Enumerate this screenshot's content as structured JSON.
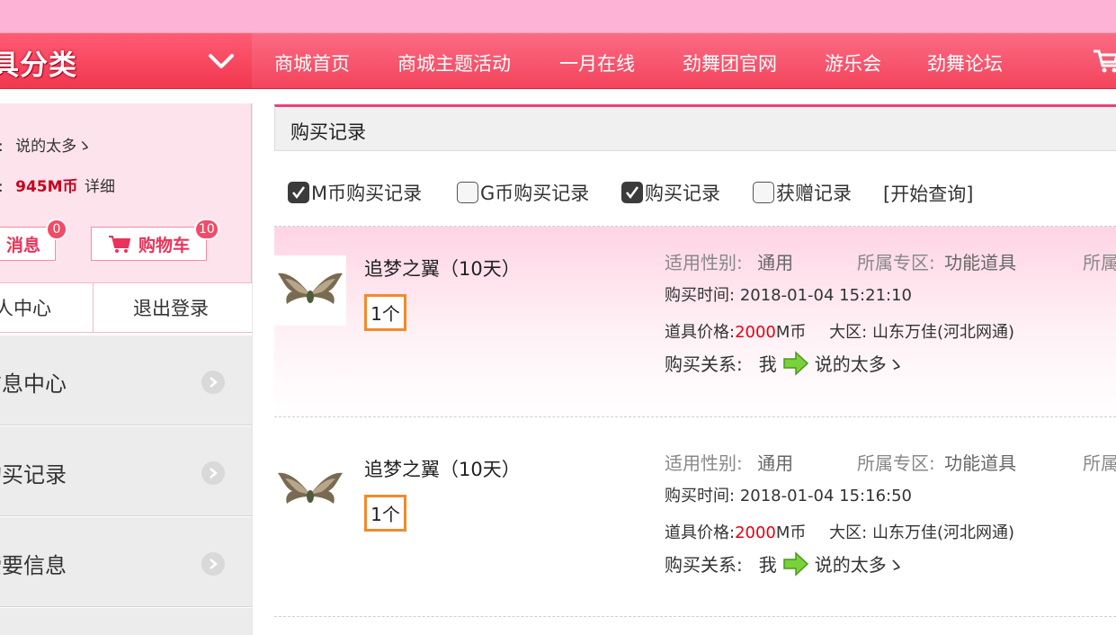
{
  "nav": {
    "category_title": "具分类",
    "links": [
      "商城首页",
      "商城主题活动",
      "一月在线",
      "劲舞团官网",
      "游乐会",
      "劲舞论坛"
    ]
  },
  "user": {
    "name_prefix": ":",
    "name": "说的太多ゝ",
    "balance_prefix": ":",
    "balance": "945M币",
    "detail_link": "详细",
    "messages_label": "消息",
    "messages_count": "0",
    "cart_label": "购物车",
    "cart_count": "10",
    "center_link": "人中心",
    "logout_link": "退出登录"
  },
  "sidebar": {
    "items": [
      {
        "label": "信息中心"
      },
      {
        "label": "购买记录"
      },
      {
        "label": "索要信息"
      }
    ]
  },
  "main": {
    "title": "购买记录",
    "filters": [
      {
        "label": "M币购买记录",
        "checked": true
      },
      {
        "label": "G币购买记录",
        "checked": false
      },
      {
        "label": "购买记录",
        "checked": true
      },
      {
        "label": "获赠记录",
        "checked": false
      }
    ],
    "query_button": "[开始查询]"
  },
  "labels": {
    "gender": "适用性别:",
    "zone": "所属专区:",
    "zone_cut": "所属",
    "time": "购买时间:",
    "price": "道具价格:",
    "price_unit": "M币",
    "region": "大区:",
    "relation": "购买关系:",
    "me": "我"
  },
  "records": [
    {
      "name": "追梦之翼（10天）",
      "qty": "1个",
      "gender": "通用",
      "zone": "功能道具",
      "time": "2018-01-04 15:21:10",
      "price": "2000",
      "region": "山东万佳(河北网通)",
      "to": "说的太多ゝ"
    },
    {
      "name": "追梦之翼（10天）",
      "qty": "1个",
      "gender": "通用",
      "zone": "功能道具",
      "time": "2018-01-04 15:16:50",
      "price": "2000",
      "region": "山东万佳(河北网通)",
      "to": "说的太多ゝ"
    }
  ],
  "colors": {
    "nav_bg": "#f3445c",
    "accent_pink": "#e8417a",
    "price_red": "#e60012",
    "qty_border": "#f28a2a"
  }
}
